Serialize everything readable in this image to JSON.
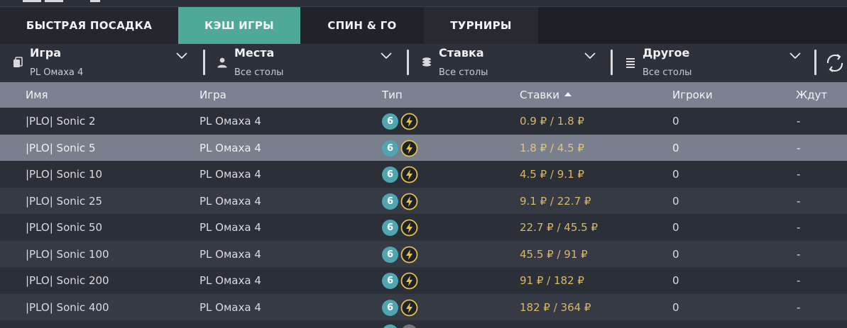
{
  "tabs": [
    {
      "label": "БЫСТРАЯ ПОСАДКА",
      "active": false
    },
    {
      "label": "КЭШ ИГРЫ",
      "active": true
    },
    {
      "label": "СПИН & ГО",
      "active": false
    },
    {
      "label": "ТУРНИРЫ",
      "active": false
    }
  ],
  "filters": {
    "game": {
      "title": "Игра",
      "value": "PL Омаха 4",
      "icon": "cards-icon"
    },
    "seats": {
      "title": "Места",
      "value": "Все столы",
      "icon": "person-icon"
    },
    "stakes": {
      "title": "Ставка",
      "value": "Все столы",
      "icon": "chips-icon"
    },
    "other": {
      "title": "Другое",
      "value": "Все столы",
      "icon": "list-icon"
    }
  },
  "columns": {
    "name": "Имя",
    "game": "Игра",
    "type": "Тип",
    "stakes": "Ставки",
    "players": "Игроки",
    "waiting": "Ждут"
  },
  "rows": [
    {
      "name": "|PLO| Sonic 2",
      "game": "PL Омаха 4",
      "seats": "6",
      "stakes": "0.9 ₽ / 1.8 ₽",
      "players": "0",
      "waiting": "-"
    },
    {
      "name": "|PLO| Sonic 5",
      "game": "PL Омаха 4",
      "seats": "6",
      "stakes": "1.8 ₽ / 4.5 ₽",
      "players": "0",
      "waiting": "-"
    },
    {
      "name": "|PLO| Sonic 10",
      "game": "PL Омаха 4",
      "seats": "6",
      "stakes": "4.5 ₽ / 9.1 ₽",
      "players": "0",
      "waiting": "-"
    },
    {
      "name": "|PLO| Sonic 25",
      "game": "PL Омаха 4",
      "seats": "6",
      "stakes": "9.1 ₽ / 22.7 ₽",
      "players": "0",
      "waiting": "-"
    },
    {
      "name": "|PLO| Sonic 50",
      "game": "PL Омаха 4",
      "seats": "6",
      "stakes": "22.7 ₽ / 45.5 ₽",
      "players": "0",
      "waiting": "-"
    },
    {
      "name": "|PLO| Sonic 100",
      "game": "PL Омаха 4",
      "seats": "6",
      "stakes": "45.5 ₽ / 91 ₽",
      "players": "0",
      "waiting": "-"
    },
    {
      "name": "|PLO| Sonic 200",
      "game": "PL Омаха 4",
      "seats": "6",
      "stakes": "91 ₽ / 182 ₽",
      "players": "0",
      "waiting": "-"
    },
    {
      "name": "|PLO| Sonic 400",
      "game": "PL Омаха 4",
      "seats": "6",
      "stakes": "182 ₽ / 364 ₽",
      "players": "0",
      "waiting": "-"
    }
  ],
  "colors": {
    "accent": "#4fa898",
    "stake_text": "#d8b766",
    "seat_badge": "#4fa6b1",
    "header_bg": "#7b8190"
  }
}
